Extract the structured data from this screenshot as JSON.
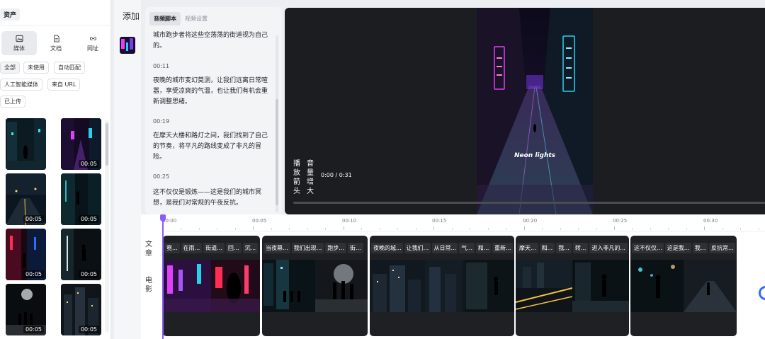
{
  "assets": {
    "title": "资产",
    "source_tabs": [
      {
        "label": "媒体",
        "icon": "image-icon",
        "active": true
      },
      {
        "label": "文档",
        "icon": "document-icon",
        "active": false
      },
      {
        "label": "网址",
        "icon": "link-icon",
        "active": false
      }
    ],
    "filters": [
      "全部",
      "未使用",
      "自动匹配",
      "人工智能媒体",
      "来自 URL",
      "已上传"
    ],
    "thumbnails": [
      {
        "duration": ""
      },
      {
        "duration": "00:05"
      },
      {
        "duration": "00:05"
      },
      {
        "duration": "00:05"
      },
      {
        "duration": "00:05"
      },
      {
        "duration": "00:05"
      },
      {
        "duration": "00:05"
      },
      {
        "duration": "00:05"
      }
    ]
  },
  "add": {
    "label": "添加"
  },
  "script": {
    "tabs": [
      {
        "label": "音频脚本",
        "active": true
      },
      {
        "label": "视频设置",
        "active": false
      }
    ],
    "paragraphs": [
      {
        "time": "",
        "text": "城市跑步者将这些空荡荡的街道视为自己的。"
      },
      {
        "time": "00:11",
        "text": "夜晚的城市变幻莫测，让我们远离日常喧嚣，享受凉爽的气温，也让我们有机会重新调整思绪。"
      },
      {
        "time": "00:19",
        "text": "在摩天大楼和路灯之间，我们找到了自己的节奏，将平凡的路线变成了非凡的冒险。"
      },
      {
        "time": "00:25",
        "text": "这不仅仅是锻炼——这是我们的城市冥想，是我们对常规的午夜反抗。"
      }
    ]
  },
  "player": {
    "caption": "Neon lights",
    "play_button": "播放箭头",
    "volume_button": "音量增大",
    "time": "0:00 / 0:31",
    "progress": 0
  },
  "timeline": {
    "ruler": [
      "00:00",
      "00:05",
      "00:10",
      "00:15",
      "00:20",
      "00:25",
      "00:30"
    ],
    "tracks": {
      "script_label": "文章",
      "video_label": "电影"
    },
    "clips": [
      {
        "words": [
          "霓...",
          "在雨...",
          "街道...",
          "回...",
          "沉..."
        ]
      },
      {
        "words": [
          "当夜幕...",
          "我们出现...",
          "跑步...",
          "街..."
        ]
      },
      {
        "words": [
          "夜晚的城...",
          "让我们...",
          "从日常...",
          "气...",
          "和...",
          "重新..."
        ]
      },
      {
        "words": [
          "摩天...",
          "和...",
          "我...",
          "转...",
          "进入非凡的..."
        ]
      },
      {
        "words": [
          "这不仅仅...",
          "这是我...",
          "我...",
          "反抗常..."
        ]
      }
    ]
  },
  "colors": {
    "accent": "#8b5cf6",
    "neon_pink": "#e040fb",
    "neon_cyan": "#22d3ee",
    "link_blue": "#2f6bff"
  }
}
